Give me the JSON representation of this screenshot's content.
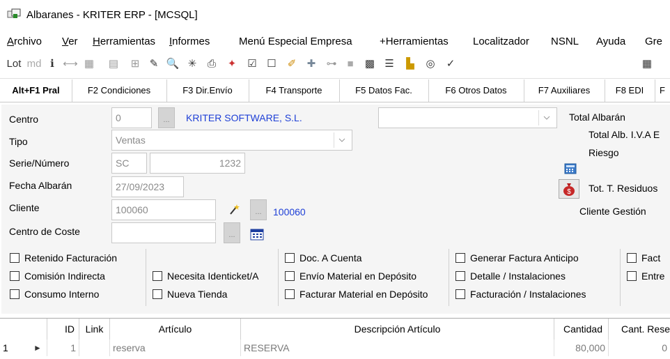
{
  "window": {
    "title": "Albaranes - KRITER ERP -  [MCSQL]"
  },
  "menu": [
    "Archivo",
    "Ver",
    "Herramientas",
    "Informes",
    "Menú Especial Empresa",
    "+Herramientas",
    "Localitzador",
    "NSNL",
    "Ayuda",
    "Gre"
  ],
  "toolbar": {
    "lot": "Lot",
    "md": "md"
  },
  "tabs": [
    "Alt+F1 Pral",
    "F2 Condiciones",
    "F3 Dir.Envío",
    "F4 Transporte",
    "F5 Datos Fac.",
    "F6 Otros Datos",
    "F7 Auxiliares",
    "F8 EDI",
    "F"
  ],
  "form": {
    "centro_label": "Centro",
    "centro_value": "0",
    "centro_name": "KRITER SOFTWARE, S.L.",
    "btn_dots": "...",
    "tipo_label": "Tipo",
    "tipo_value": "Ventas",
    "serie_label": "Serie/Número",
    "serie_value": "SC",
    "numero_value": "1232",
    "fecha_label": "Fecha Albarán",
    "fecha_value": "27/09/2023",
    "cliente_label": "Cliente",
    "cliente_value": "100060",
    "cliente_link": "100060",
    "coste_label": "Centro de Coste",
    "total_albaran": "Total Albarán",
    "total_iva": "Total Alb. I.V.A E",
    "riesgo": "Riesgo",
    "tot_residuos": "Tot. T. Residuos",
    "cliente_gestion": "Cliente Gestión"
  },
  "checkboxes": {
    "retenido": "Retenido Facturación",
    "comision": "Comisión Indirecta",
    "consumo": "Consumo Interno",
    "identicket": "Necesita Identicket/A",
    "nueva_tienda": "Nueva Tienda",
    "doc_cuenta": "Doc. A Cuenta",
    "envio_material": "Envío Material en Depósito",
    "facturar_material": "Facturar Material en Depósito",
    "generar_factura": "Generar Factura Anticipo",
    "detalle_inst": "Detalle / Instalaciones",
    "facturacion_inst": "Facturación / Instalaciones",
    "fact": "Fact",
    "entre": "Entre"
  },
  "grid": {
    "headers": [
      "",
      "ID",
      "Link",
      "Artículo",
      "Descripción Artículo",
      "Cantidad",
      "Cant. Rese"
    ],
    "rows": [
      {
        "num": "1",
        "id": "1",
        "link": "",
        "articulo": "reserva",
        "descripcion": "RESERVA",
        "cantidad": "80,000",
        "cant_res": "0"
      }
    ]
  }
}
